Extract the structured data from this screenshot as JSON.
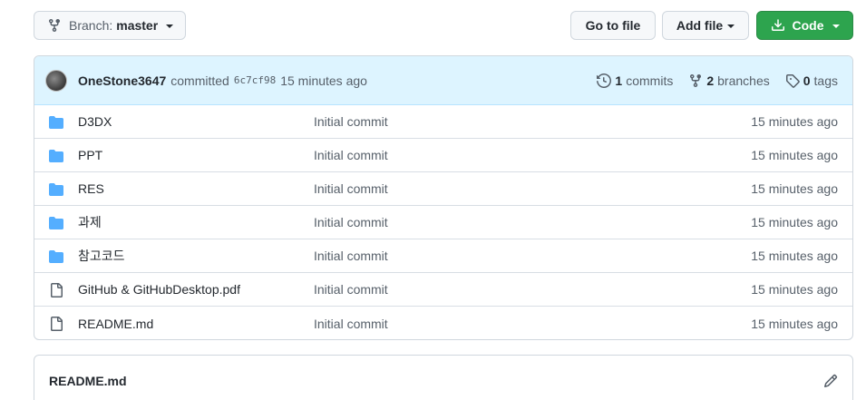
{
  "toolbar": {
    "branch_label": "Branch:",
    "branch_value": "master",
    "goto_file": "Go to file",
    "add_file": "Add file",
    "code": "Code"
  },
  "commit": {
    "author": "OneStone3647",
    "verb": "committed",
    "sha": "6c7cf98",
    "time": "15 minutes ago",
    "commits_count": "1",
    "commits_label": "commits",
    "branches_count": "2",
    "branches_label": "branches",
    "tags_count": "0",
    "tags_label": "tags"
  },
  "files": [
    {
      "name": "D3DX",
      "type": "folder",
      "message": "Initial commit",
      "time": "15 minutes ago"
    },
    {
      "name": "PPT",
      "type": "folder",
      "message": "Initial commit",
      "time": "15 minutes ago"
    },
    {
      "name": "RES",
      "type": "folder",
      "message": "Initial commit",
      "time": "15 minutes ago"
    },
    {
      "name": "과제",
      "type": "folder",
      "message": "Initial commit",
      "time": "15 minutes ago"
    },
    {
      "name": "참고코드",
      "type": "folder",
      "message": "Initial commit",
      "time": "15 minutes ago"
    },
    {
      "name": "GitHub & GitHubDesktop.pdf",
      "type": "file",
      "message": "Initial commit",
      "time": "15 minutes ago"
    },
    {
      "name": "README.md",
      "type": "file",
      "message": "Initial commit",
      "time": "15 minutes ago"
    }
  ],
  "readme": {
    "title": "README.md"
  },
  "colors": {
    "folder": "#54aeff",
    "code_button": "#2da44e",
    "header_bg": "#ddf4ff"
  },
  "icons": {
    "folder": "folder-icon",
    "file": "file-icon"
  }
}
